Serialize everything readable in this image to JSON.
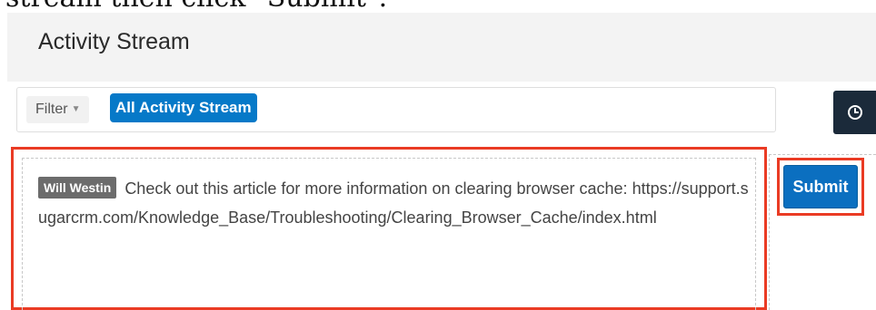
{
  "caption": "stream then click \"Submit\".",
  "header": {
    "title": "Activity Stream"
  },
  "filter": {
    "toggle_label": "Filter",
    "active_filter": "All Activity Stream"
  },
  "toolbar": {
    "timeline_icon": "clock-icon"
  },
  "compose": {
    "mention": "Will Westin",
    "text": "Check out this article for more information on clearing browser cache:",
    "url": "https://support.sugarcrm.com/Knowledge_Base/Troubleshooting/Clearing_Browser_Cache/index.html",
    "submit_label": "Submit"
  },
  "colors": {
    "highlight": "#ea3b24",
    "primary": "#0679c8",
    "dark_button": "#1b2a3a",
    "mention_bg": "#6c6c6c"
  }
}
